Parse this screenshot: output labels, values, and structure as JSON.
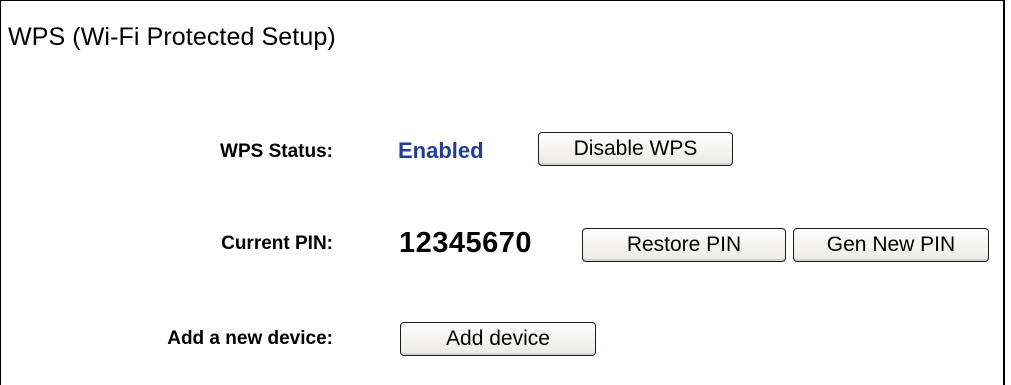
{
  "section": {
    "title": "WPS (Wi-Fi Protected Setup)"
  },
  "wps_status": {
    "label": "WPS Status:",
    "value": "Enabled",
    "value_color": "#1f3f8f",
    "button_label": "Disable WPS"
  },
  "current_pin": {
    "label": "Current PIN:",
    "value": "12345670",
    "restore_button_label": "Restore PIN",
    "gen_button_label": "Gen New PIN"
  },
  "add_device": {
    "label": "Add a new device:",
    "button_label": "Add device"
  }
}
